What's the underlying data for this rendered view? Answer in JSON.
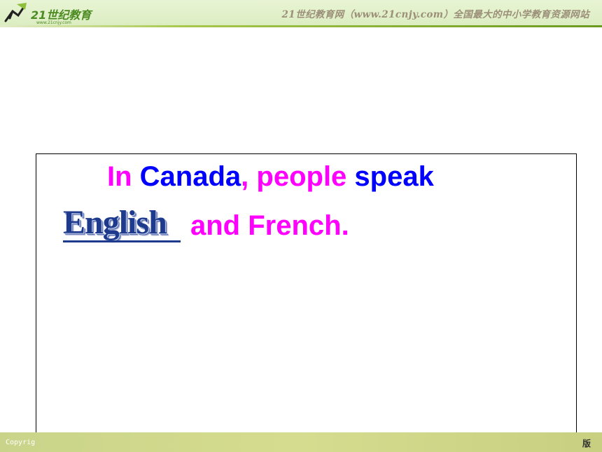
{
  "header": {
    "logo_text": "21世纪教育",
    "logo_url": "www.21cnjy.com",
    "title": "21世纪教育网（www.21cnjy.com）全国最大的中小学教育资源网站"
  },
  "slide": {
    "line1": [
      {
        "text": "In ",
        "color": "magenta"
      },
      {
        "text": "Canada",
        "color": "blue"
      },
      {
        "text": ", people ",
        "color": "magenta"
      },
      {
        "text": "speak",
        "color": "blue"
      }
    ],
    "answer_word": "English",
    "line2_text": "and French."
  },
  "footer": {
    "left_text": "Copyrig",
    "right_text": "版"
  }
}
